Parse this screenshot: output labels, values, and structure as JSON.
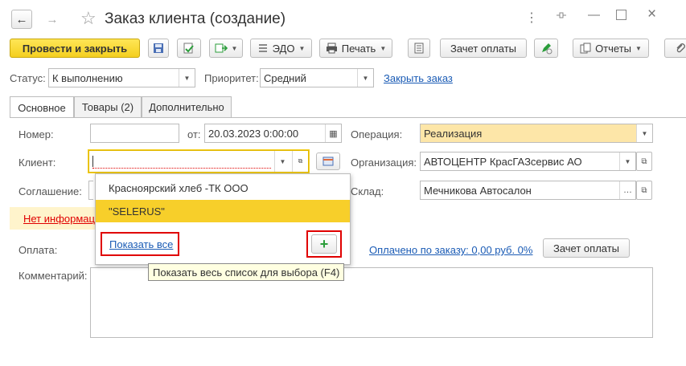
{
  "window": {
    "title": "Заказ клиента (создание)"
  },
  "toolbar": {
    "post_close": "Провести и закрыть",
    "edo": "ЭДО",
    "print": "Печать",
    "payment_offset": "Зачет оплаты",
    "reports": "Отчеты"
  },
  "status_row": {
    "status_label": "Статус:",
    "status_value": "К выполнению",
    "priority_label": "Приоритет:",
    "priority_value": "Средний",
    "close_order": "Закрыть заказ"
  },
  "tabs": [
    {
      "label": "Основное"
    },
    {
      "label": "Товары (2)"
    },
    {
      "label": "Дополнительно"
    }
  ],
  "form": {
    "number_label": "Номер:",
    "number_value": "",
    "date_from_label": "от:",
    "date_value": "20.03.2023  0:00:00",
    "operation_label": "Операция:",
    "operation_value": "Реализация",
    "client_label": "Клиент:",
    "client_value": "",
    "organization_label": "Организация:",
    "organization_value": "АВТОЦЕНТР КрасГАЗсервис АО",
    "agreement_label": "Соглашение:",
    "warehouse_label": "Склад:",
    "warehouse_value": "Мечникова Автосалон",
    "no_info": "Нет информац",
    "payment_label": "Оплата:",
    "paid_link": "Оплачено по заказу: 0,00 руб. 0%",
    "payment_offset_btn": "Зачет оплаты",
    "comment_label": "Комментарий:",
    "comment_value": ""
  },
  "dropdown": {
    "items": [
      "Красноярский хлеб -ТК ООО",
      "\"SELERUS\""
    ],
    "show_all": "Показать все",
    "add_symbol": "+"
  },
  "tooltip": {
    "text": "Показать весь список для выбора (F4)"
  },
  "colors": {
    "accent_yellow": "#f4cf1f",
    "highlight_red": "#e00000",
    "link_blue": "#1a5bb5",
    "operation_bg": "#fde6a8"
  }
}
